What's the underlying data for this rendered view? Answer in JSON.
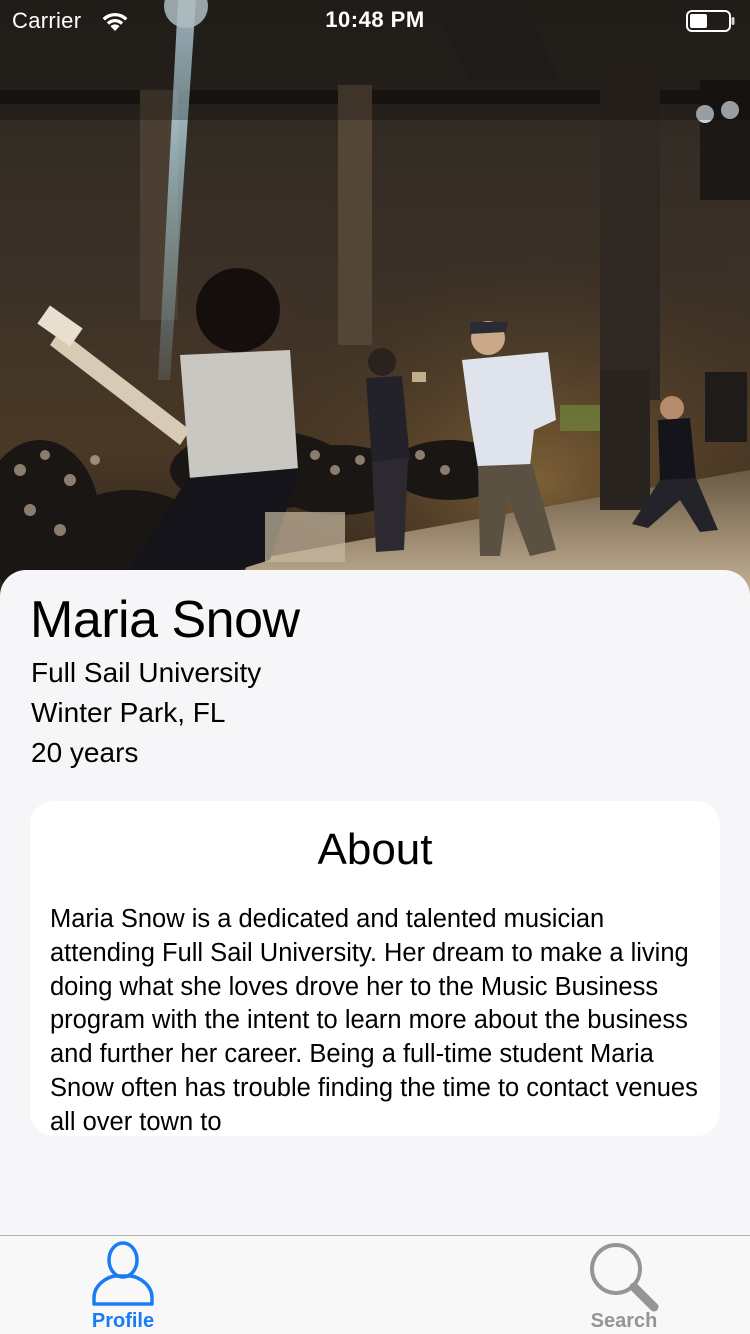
{
  "status_bar": {
    "carrier": "Carrier",
    "time": "10:48 PM",
    "wifi_icon": "wifi-icon",
    "battery_icon": "battery-icon"
  },
  "hero": {
    "image_icon": "concert-photo"
  },
  "profile": {
    "name": "Maria Snow",
    "school": "Full Sail University",
    "location": "Winter Park, FL",
    "age": "20 years"
  },
  "about": {
    "title": "About",
    "text": "Maria Snow is a dedicated and talented musician attending Full Sail University. Her dream to make a living doing what she loves drove her to the Music Business program with the intent to learn more about the business and further her career. Being a full-time student Maria Snow often has trouble finding the time to contact venues all over town to"
  },
  "tabs": [
    {
      "label": "Profile",
      "icon": "person-icon",
      "active": true
    },
    {
      "label": "Search",
      "icon": "magnifier-icon",
      "active": false
    }
  ],
  "colors": {
    "accent": "#1a7cf5",
    "inactive": "#959595",
    "card_background": "#f6f6f8",
    "about_background": "#ffffff"
  }
}
